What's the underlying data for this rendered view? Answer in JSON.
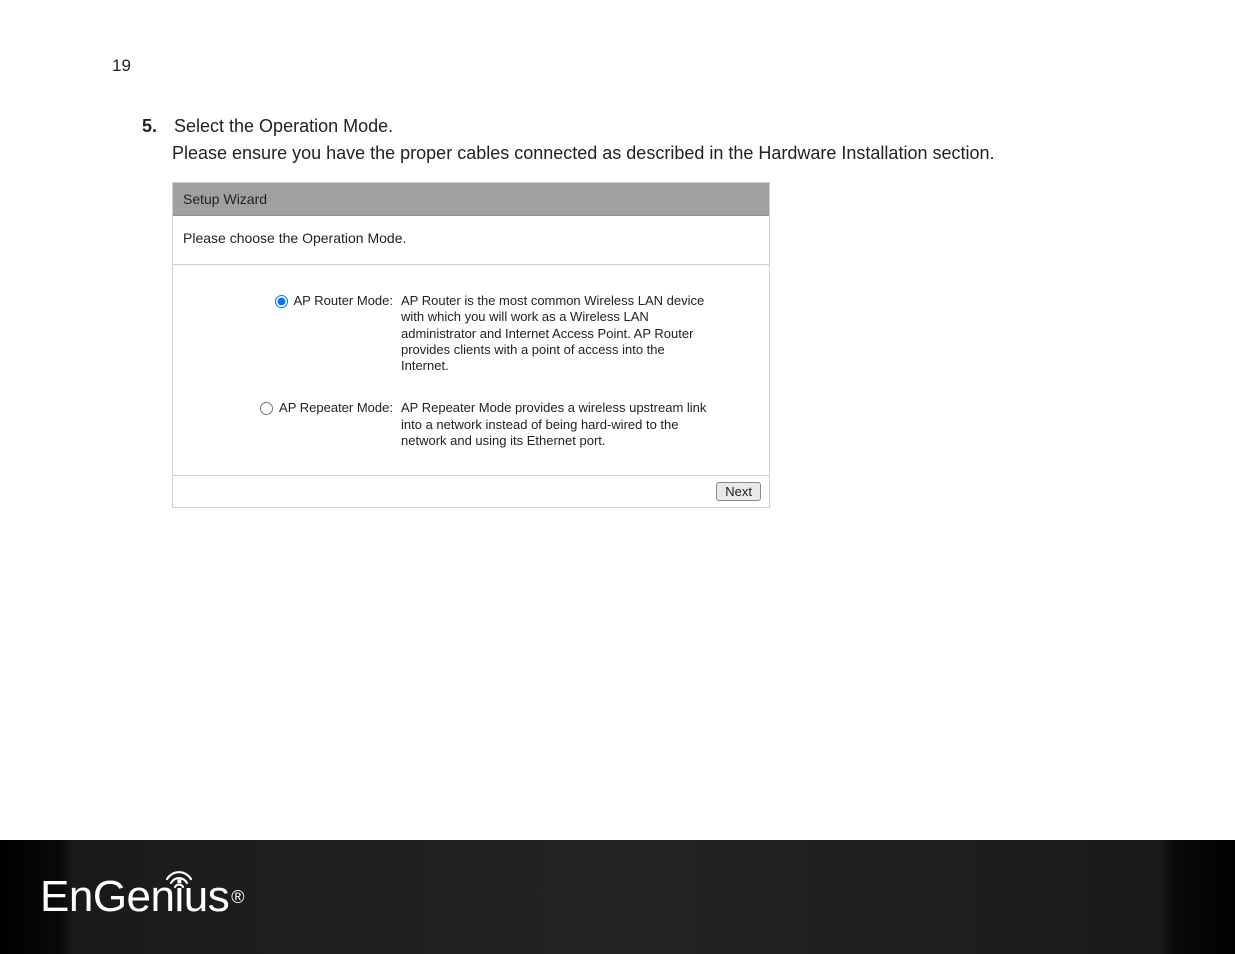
{
  "page_number": "19",
  "step": {
    "number": "5.",
    "title": "Select the Operation Mode.",
    "description": "Please ensure you have the proper cables connected as described in the Hardware Installation section."
  },
  "wizard": {
    "title": "Setup Wizard",
    "prompt": "Please choose the Operation Mode.",
    "modes": [
      {
        "label": "AP Router Mode:",
        "description": "AP Router is the most common Wireless LAN device with which you will work as a Wireless LAN administrator and Internet Access Point. AP Router provides clients with a point of access into the Internet.",
        "selected": true
      },
      {
        "label": "AP Repeater Mode:",
        "description": "AP Repeater Mode provides a wireless upstream link into a network instead of being hard-wired to the network and using its Ethernet port.",
        "selected": false
      }
    ],
    "next_button": "Next"
  },
  "footer": {
    "brand": "EnGenius",
    "registered": "®"
  }
}
